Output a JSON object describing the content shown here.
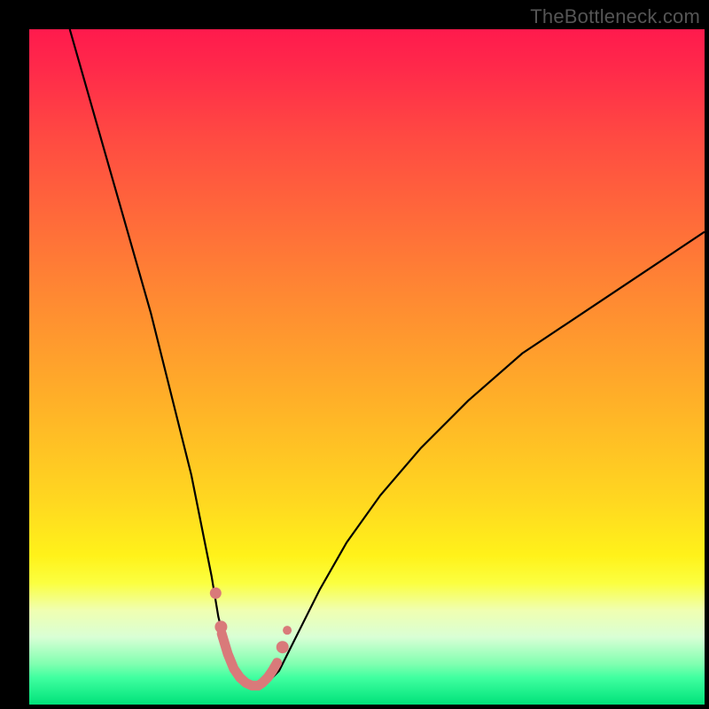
{
  "watermark": "TheBottleneck.com",
  "chart_data": {
    "type": "line",
    "title": "",
    "xlabel": "",
    "ylabel": "",
    "xlim": [
      0,
      100
    ],
    "ylim": [
      0,
      100
    ],
    "grid": false,
    "legend": false,
    "series": [
      {
        "name": "bottleneck-curve",
        "stroke": "#000000",
        "stroke_width": 2.2,
        "x": [
          6,
          8,
          10,
          12,
          14,
          16,
          18,
          20,
          22,
          24,
          26,
          27,
          28,
          29,
          30,
          31,
          32,
          33,
          34,
          35,
          36,
          37,
          38,
          40,
          43,
          47,
          52,
          58,
          65,
          73,
          82,
          91,
          100
        ],
        "y": [
          100,
          93,
          86,
          79,
          72,
          65,
          58,
          50,
          42,
          34,
          24,
          19,
          13,
          9,
          6,
          4,
          3,
          2.5,
          2.5,
          3,
          4,
          5,
          7,
          11,
          17,
          24,
          31,
          38,
          45,
          52,
          58,
          64,
          70
        ]
      },
      {
        "name": "curve-highlight",
        "stroke": "#d97a7a",
        "stroke_width": 11,
        "linecap": "round",
        "x": [
          28.5,
          29.4,
          30.3,
          31.2,
          32.1,
          33.0,
          33.9,
          34.5,
          35.3,
          36.0,
          36.7
        ],
        "y": [
          10.5,
          7.5,
          5.3,
          4.0,
          3.2,
          2.8,
          2.8,
          3.2,
          4.0,
          5.0,
          6.2
        ]
      }
    ],
    "markers": [
      {
        "name": "left-upper-dot",
        "x": 27.6,
        "y": 16.5,
        "r": 6.5,
        "fill": "#d97a7a"
      },
      {
        "name": "left-lower-dot",
        "x": 28.4,
        "y": 11.5,
        "r": 7.0,
        "fill": "#d97a7a"
      },
      {
        "name": "right-upper-dot",
        "x": 37.5,
        "y": 8.5,
        "r": 7.0,
        "fill": "#d97a7a"
      },
      {
        "name": "right-lower-dot",
        "x": 38.2,
        "y": 11.0,
        "r": 5.0,
        "fill": "#d97a7a"
      }
    ]
  }
}
